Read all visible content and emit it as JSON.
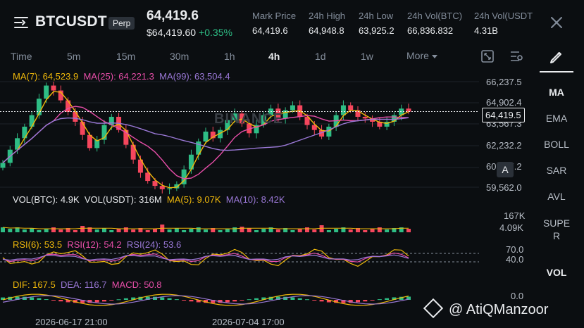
{
  "header": {
    "symbol": "BTCUSDT",
    "badge": "Perp",
    "last_price": "64,419.6",
    "fiat_price": "$64,419.60",
    "change": "+0.35%",
    "stats": [
      {
        "label": "Mark Price",
        "value": "64,419.6"
      },
      {
        "label": "24h High",
        "value": "64,948.8"
      },
      {
        "label": "24h Low",
        "value": "63,925.2"
      },
      {
        "label": "24h Vol(BTC)",
        "value": "66,836.832"
      },
      {
        "label": "24h Vol(USDT",
        "value": "4.31B"
      }
    ]
  },
  "intervals": {
    "items": [
      "Time",
      "5m",
      "15m",
      "30m",
      "1h",
      "4h",
      "1d",
      "1w"
    ],
    "active": "4h",
    "more_label": "More"
  },
  "indicator_menu": {
    "items": [
      "MA",
      "EMA",
      "BOLL",
      "SAR",
      "AVL",
      "SUPER",
      "VOL"
    ],
    "active": [
      "MA",
      "VOL"
    ]
  },
  "ma_legend": {
    "ma7": "MA(7): 64,523.9",
    "ma25": "MA(25): 64,221.3",
    "ma99": "MA(99): 63,504.4"
  },
  "price_axis": [
    "66,237.5",
    "64,902.4",
    "63,567.3",
    "62,232.2",
    "60,897.2",
    "59,562.0"
  ],
  "current_price_tag": "64,419.5",
  "watermark": "BINANCE",
  "vol_legend": {
    "btc": "VOL(BTC): 4.9K",
    "usdt": "VOL(USDT): 316M",
    "ma5": "MA(5): 9.07K",
    "ma10": "MA(10): 8.42K"
  },
  "vol_axis": [
    "167K",
    "4.09K"
  ],
  "rsi_legend": {
    "rsi6": "RSI(6): 53.5",
    "rsi12": "RSI(12): 54.2",
    "rsi24": "RSI(24): 53.6"
  },
  "rsi_axis": [
    "70.0",
    "40.0"
  ],
  "macd_legend": {
    "dif": "DIF: 167.5",
    "dea": "DEA: 116.7",
    "macd": "MACD: 50.8"
  },
  "macd_axis": [
    "0.0"
  ],
  "a_button": "A",
  "time_axis": [
    "2026-06-17 21:00",
    "2026-07-04 17:00"
  ],
  "user_watermark": "@ AtiQManzoor",
  "colors": {
    "up": "#2ebd85",
    "down": "#f6465d",
    "ma7": "#f0b90b",
    "ma25": "#e84ea9",
    "ma99": "#9a78d6"
  },
  "chart_data": {
    "type": "candlestick",
    "ma7_value": 64523.9,
    "ma25_value": 64221.3,
    "ma99_value": 63504.4,
    "ylim": [
      59562.0,
      66237.5
    ],
    "last_close": 64419.5,
    "closes": [
      61300,
      62100,
      62800,
      63500,
      64200,
      65200,
      66000,
      65700,
      65100,
      64400,
      63800,
      63000,
      62200,
      62700,
      63600,
      64100,
      63300,
      62400,
      61500,
      60700,
      60200,
      59900,
      59700,
      59750,
      60000,
      60900,
      61800,
      62600,
      63200,
      62800,
      63300,
      63900,
      64300,
      63700,
      63100,
      63600,
      64200,
      64600,
      64000,
      64500,
      64800,
      64100,
      63600,
      63300,
      62900,
      63500,
      64200,
      64800,
      64500,
      64100,
      64000,
      63800,
      63500,
      63800,
      64200,
      64600,
      64419.5
    ],
    "rsi_levels": [
      70.0,
      40.0
    ],
    "rsi6": 53.5,
    "rsi12": 54.2,
    "rsi24": 53.6,
    "dif": 167.5,
    "dea": 116.7,
    "macd": 50.8
  }
}
